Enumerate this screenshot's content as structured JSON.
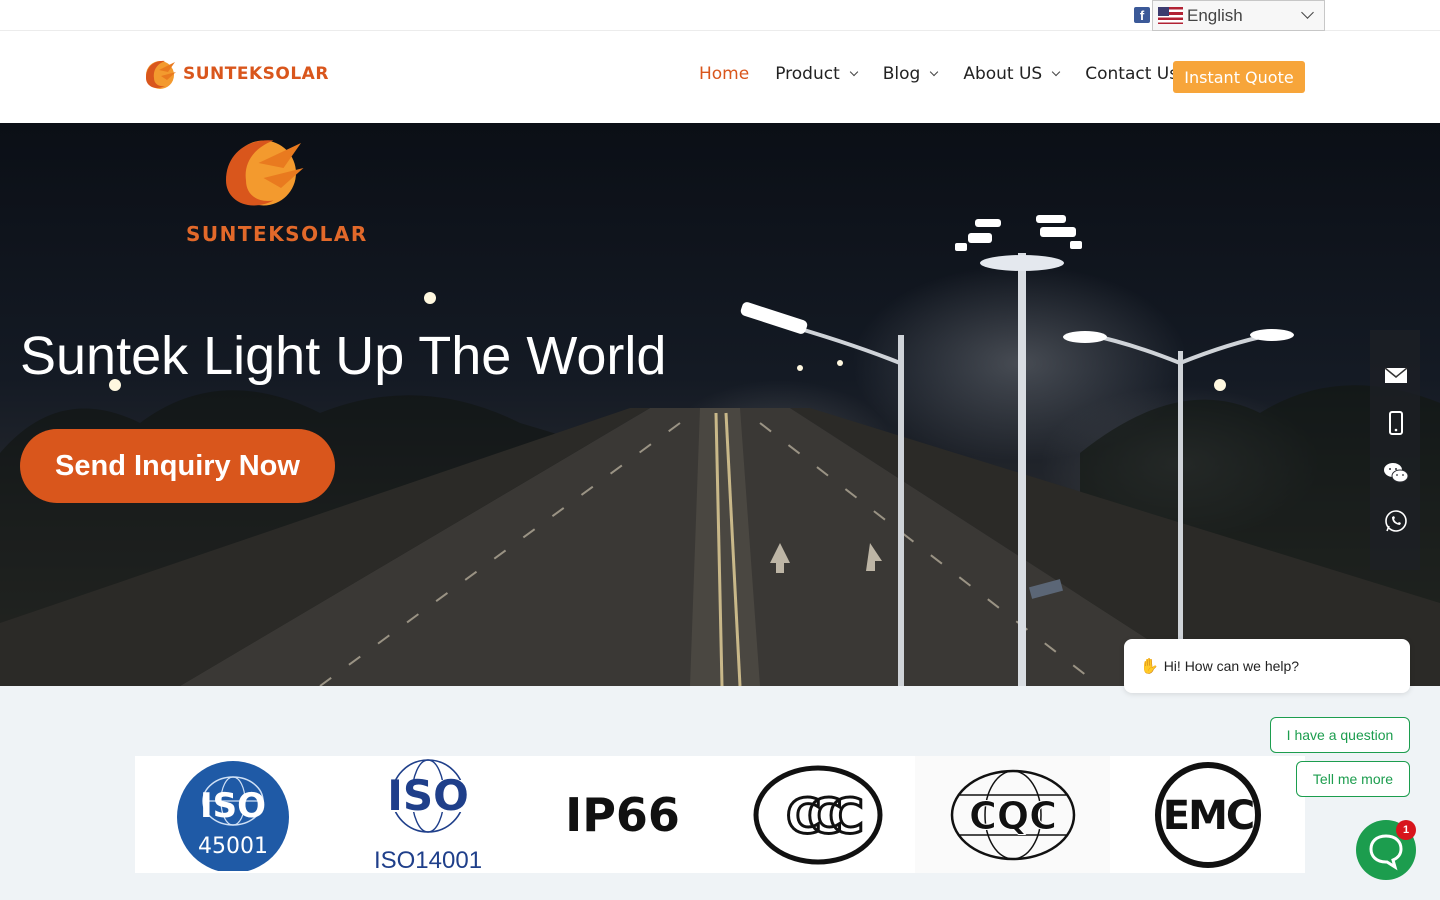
{
  "topbar": {
    "facebook_icon": "facebook-icon",
    "language": {
      "selected": "English",
      "flag_icon": "us-flag-icon"
    }
  },
  "header": {
    "logo_text": "SUNTEKSOLAR",
    "nav": [
      {
        "label": "Home",
        "active": true,
        "dropdown": false
      },
      {
        "label": "Product",
        "active": false,
        "dropdown": true
      },
      {
        "label": "Blog",
        "active": false,
        "dropdown": true
      },
      {
        "label": "About US",
        "active": false,
        "dropdown": true
      },
      {
        "label": "Contact Us",
        "active": false,
        "dropdown": false
      }
    ],
    "cta_label": "Instant Quote"
  },
  "hero": {
    "logo_text": "SUNTEKSOLAR",
    "title": "Suntek Light Up The World",
    "button_label": "Send Inquiry Now"
  },
  "side_contact": {
    "items": [
      "email-icon",
      "phone-icon",
      "wechat-icon",
      "whatsapp-icon"
    ]
  },
  "certifications": {
    "iso45001": {
      "title": "ISO",
      "number": "45001"
    },
    "iso14001": {
      "title": "ISO",
      "caption": "ISO14001"
    },
    "ip66": "IP66",
    "ccc": "CCC",
    "cqc": "CQC",
    "emc": "EMC"
  },
  "chat": {
    "greeting": "Hi! How can we help?",
    "options": [
      "I have a question",
      "Tell me more"
    ],
    "badge_count": "1"
  },
  "colors": {
    "brand_orange": "#d9561c",
    "quote_orange": "#f7a53a",
    "chat_green": "#1c9d4e",
    "cert_blue": "#1f5aa6"
  }
}
